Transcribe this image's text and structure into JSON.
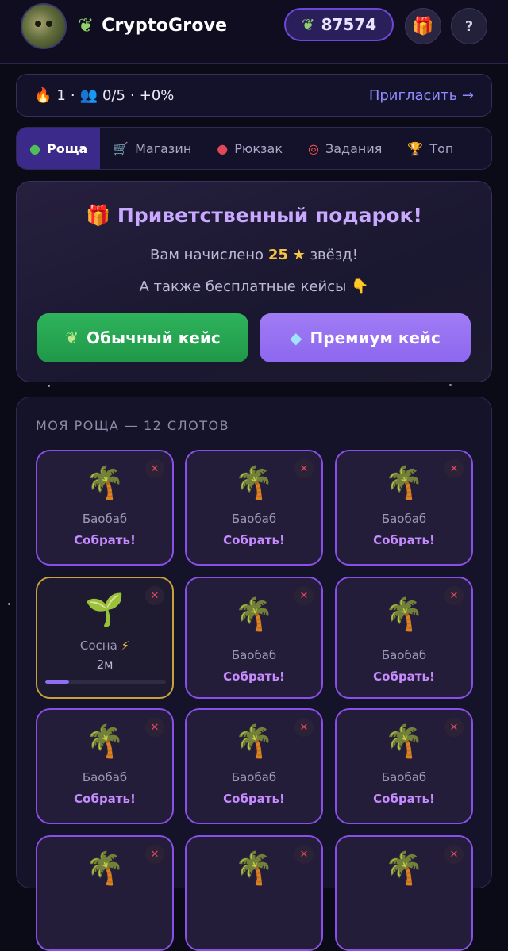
{
  "header": {
    "app_name": "CryptoGrove",
    "balance": "87574",
    "help_label": "?"
  },
  "stats": {
    "streak": "1",
    "referrals": "0/5",
    "bonus": "+0%",
    "invite_label": "Пригласить →"
  },
  "tabs": [
    {
      "label": "Роща",
      "icon": "grove-icon",
      "active": true
    },
    {
      "label": "Магазин",
      "icon": "cart-icon",
      "active": false
    },
    {
      "label": "Рюкзак",
      "icon": "backpack-icon",
      "active": false
    },
    {
      "label": "Задания",
      "icon": "target-icon",
      "active": false
    },
    {
      "label": "Топ",
      "icon": "trophy-icon",
      "active": false
    }
  ],
  "welcome": {
    "title": "Приветственный подарок!",
    "line1_prefix": "Вам начислено",
    "line1_value": "25",
    "line1_suffix": "звёзд!",
    "line2": "А также бесплатные кейсы",
    "normal_case_label": "Обычный кейс",
    "premium_case_label": "Премиум кейс"
  },
  "grove": {
    "title": "МОЯ РОЩА — 12 СЛОТОВ",
    "slots": [
      {
        "plant": "Баобаб",
        "action": "Собрать!",
        "state": "ready",
        "icon": "palm-tree-icon"
      },
      {
        "plant": "Баобаб",
        "action": "Собрать!",
        "state": "ready",
        "icon": "palm-tree-icon"
      },
      {
        "plant": "Баобаб",
        "action": "Собрать!",
        "state": "ready",
        "icon": "palm-tree-icon"
      },
      {
        "plant": "Сосна",
        "timer": "2м",
        "state": "growing",
        "progress": 0.2,
        "icon": "seedling-icon"
      },
      {
        "plant": "Баобаб",
        "action": "Собрать!",
        "state": "ready",
        "icon": "palm-tree-icon"
      },
      {
        "plant": "Баобаб",
        "action": "Собрать!",
        "state": "ready",
        "icon": "palm-tree-icon"
      },
      {
        "plant": "Баобаб",
        "action": "Собрать!",
        "state": "ready",
        "icon": "palm-tree-icon"
      },
      {
        "plant": "Баобаб",
        "action": "Собрать!",
        "state": "ready",
        "icon": "palm-tree-icon"
      },
      {
        "plant": "Баобаб",
        "action": "Собрать!",
        "state": "ready",
        "icon": "palm-tree-icon"
      }
    ]
  },
  "colors": {
    "accent": "#8a4fe8",
    "collect": "#c58bff",
    "growing_border": "#c7a13a",
    "green_button": "#2fb35c",
    "purple_button": "#a07cf5"
  }
}
